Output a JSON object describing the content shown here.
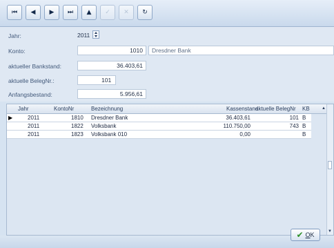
{
  "toolbar": {
    "buttons": [
      {
        "icon": "first-record-icon",
        "glyph": "⏮",
        "enabled": true
      },
      {
        "icon": "previous-record-icon",
        "glyph": "◀",
        "enabled": true
      },
      {
        "icon": "next-record-icon",
        "glyph": "▶",
        "enabled": true
      },
      {
        "icon": "last-record-icon",
        "glyph": "⏭",
        "enabled": true
      },
      {
        "icon": "insert-record-icon",
        "glyph": "▲",
        "enabled": true
      },
      {
        "icon": "post-edit-icon",
        "glyph": "✓",
        "enabled": false
      },
      {
        "icon": "cancel-edit-icon",
        "glyph": "✕",
        "enabled": false
      },
      {
        "icon": "refresh-icon",
        "glyph": "↻",
        "enabled": true
      }
    ]
  },
  "form": {
    "jahr_label": "Jahr:",
    "jahr_value": "2011",
    "konto_label": "Konto:",
    "konto_value": "1010",
    "konto_name": "Dresdner Bank",
    "bankstand_label": "aktueller Bankstand:",
    "bankstand_value": "36.403,61",
    "belegnr_label": "aktuelle BelegNr.:",
    "belegnr_value": "101",
    "anfangsbestand_label": "Anfangsbestand:",
    "anfangsbestand_value": "5.956,61"
  },
  "grid": {
    "headers": [
      "Jahr",
      "KontoNr",
      "Bezeichnung",
      "Kassenstand",
      "aktuelle BelegNr",
      "KB"
    ],
    "rows": [
      {
        "jahr": "2011",
        "kontonr": "1810",
        "bezeichnung": "Dresdner Bank",
        "kassenstand": "36.403,61",
        "belegnr": "101",
        "kb": "B",
        "current": true
      },
      {
        "jahr": "2011",
        "kontonr": "1822",
        "bezeichnung": "Volksbank",
        "kassenstand": "110.750,00",
        "belegnr": "743",
        "kb": "B",
        "current": false
      },
      {
        "jahr": "2011",
        "kontonr": "1823",
        "bezeichnung": "Volksbank 010",
        "kassenstand": "0,00",
        "belegnr": "",
        "kb": "B",
        "current": false
      }
    ],
    "current_row_marker": "▶"
  },
  "footer": {
    "ok_label": "OK",
    "ok_mnemonic": "O",
    "ok_rest": "K"
  }
}
